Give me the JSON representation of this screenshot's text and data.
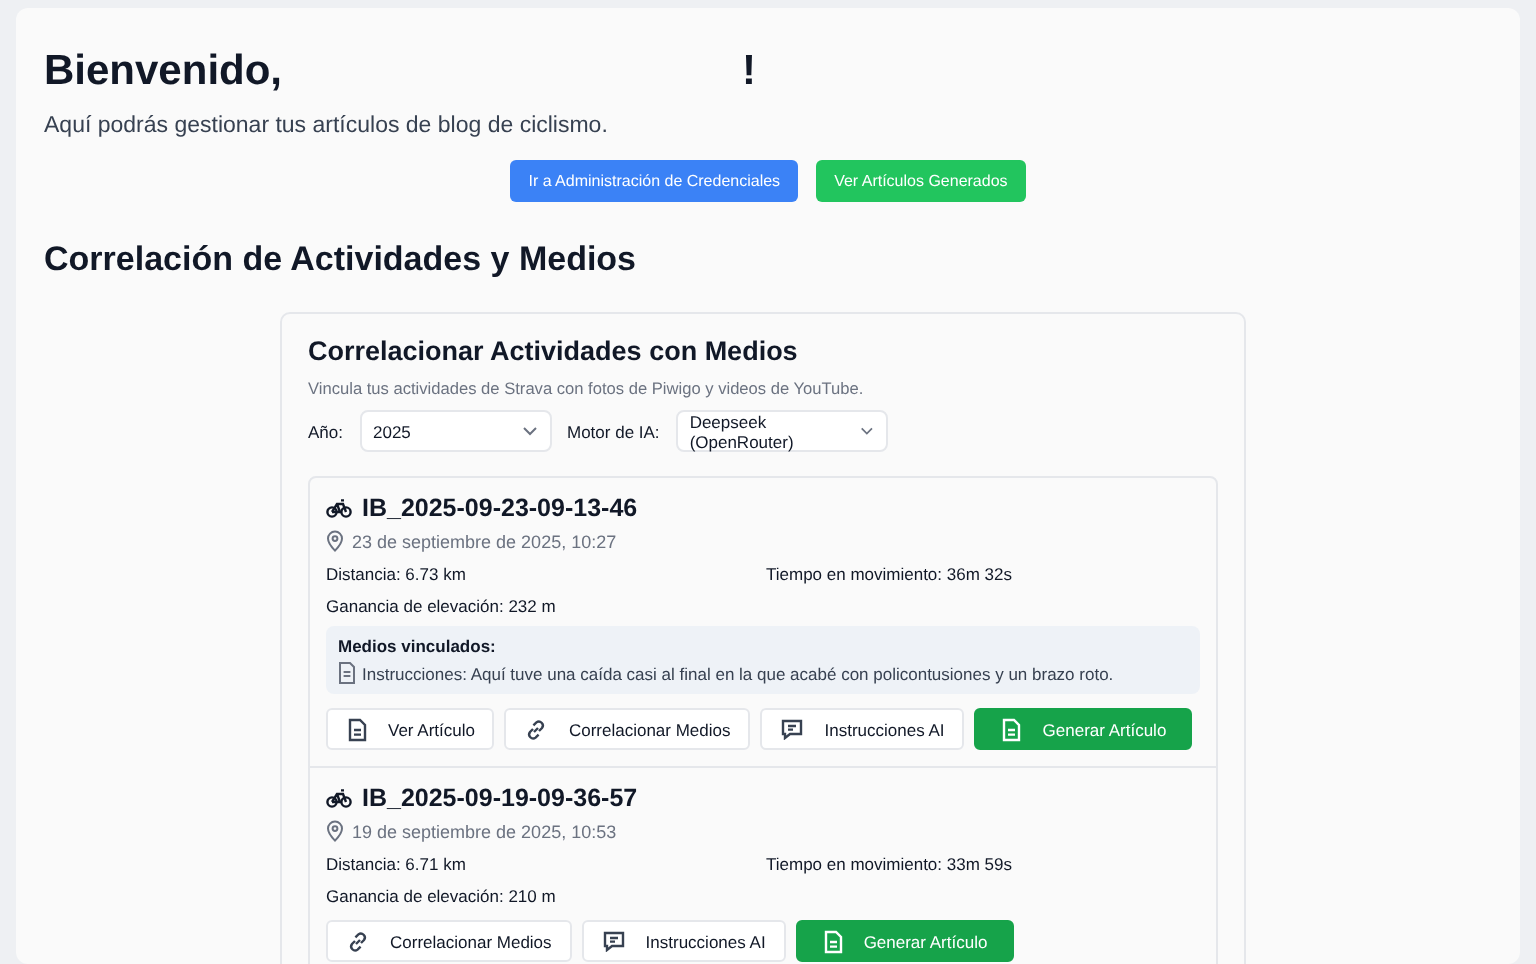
{
  "header": {
    "greeting": "Bienvenido,",
    "exclamation": "!",
    "subtitle": "Aquí podrás gestionar tus artículos de blog de ciclismo."
  },
  "actions": [
    {
      "label": "Ir a Administración de Credenciales",
      "kind": "blue"
    },
    {
      "label": "Ver Artículos Generados",
      "kind": "green"
    }
  ],
  "section_title": "Correlación de Actividades y Medios",
  "panel": {
    "title": "Correlacionar Actividades con Medios",
    "description": "Vincula tus actividades de Strava con fotos de Piwigo y videos de YouTube.",
    "filters": [
      {
        "label": "Año:",
        "value": "2025"
      },
      {
        "label": "Motor de IA:",
        "value": "Deepseek (OpenRouter)"
      }
    ],
    "activities": [
      {
        "name": "IB_2025-09-23-09-13-46",
        "date": "23 de septiembre de 2025, 10:27",
        "distance": "Distancia: 6.73 km",
        "moving_time": "Tiempo en movimiento: 36m 32s",
        "elevation": "Ganancia de elevación: 232 m",
        "linked_media": {
          "title": "Medios vinculados:",
          "items": [
            "Instrucciones: Aquí tuve una caída casi al final en la que acabé con policontusiones y un brazo roto."
          ]
        },
        "buttons": [
          {
            "label": "Ver Artículo",
            "kind": "view"
          },
          {
            "label": "Correlacionar Medios",
            "kind": "link"
          },
          {
            "label": "Instrucciones AI",
            "kind": "ai"
          },
          {
            "label": "Generar Artículo",
            "kind": "generate"
          }
        ]
      },
      {
        "name": "IB_2025-09-19-09-36-57",
        "date": "19 de septiembre de 2025, 10:53",
        "distance": "Distancia: 6.71 km",
        "moving_time": "Tiempo en movimiento: 33m 59s",
        "elevation": "Ganancia de elevación: 210 m",
        "buttons": [
          {
            "label": "Correlacionar Medios",
            "kind": "link"
          },
          {
            "label": "Instrucciones AI",
            "kind": "ai"
          },
          {
            "label": "Generar Artículo",
            "kind": "generate"
          }
        ]
      }
    ]
  }
}
